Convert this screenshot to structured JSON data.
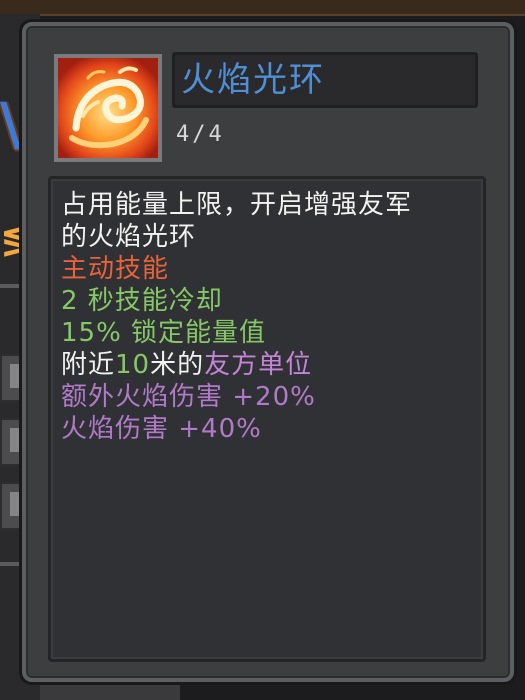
{
  "skill": {
    "name": "火焰光环",
    "level": "4/4",
    "icon": "fire-ring-icon"
  },
  "description": {
    "intro_line1": "占用能量上限，开启增强友军",
    "intro_line2": "的火焰光环",
    "type": "主动技能",
    "cooldown": "2 秒技能冷却",
    "energy_lock": "15% 锁定能量值",
    "range_prefix": "附近",
    "range_value": "10",
    "range_mid": "米的",
    "range_target": "友方单位",
    "bonus_fire_damage": "额外火焰伤害 +20%",
    "fire_damage": "火焰伤害 +40%"
  },
  "colors": {
    "title": "#4f8fd6",
    "skill_type": "#e8623a",
    "stat_green": "#86c866",
    "stat_purple": "#c484d8",
    "text_white": "#f2f2f2"
  }
}
